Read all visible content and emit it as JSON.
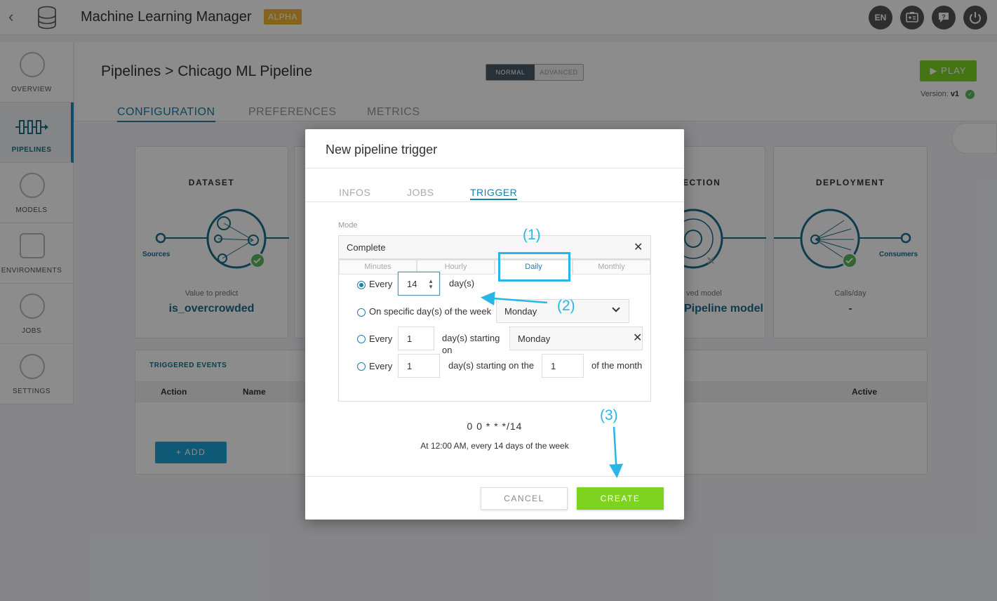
{
  "header": {
    "back_icon": "chevron-left-icon",
    "logo_icon": "database-icon",
    "title": "Machine Learning Manager",
    "badge": "ALPHA",
    "lang": "EN",
    "actions": [
      "id-card-icon",
      "help-chat-icon",
      "power-icon"
    ]
  },
  "sidebar": {
    "items": [
      {
        "label": "OVERVIEW",
        "icon": "dashboard-icon"
      },
      {
        "label": "PIPELINES",
        "icon": "pipelines-icon",
        "active": true
      },
      {
        "label": "MODELS",
        "icon": "atom-icon"
      },
      {
        "label": "ENVIRONMENTS",
        "icon": "environments-icon"
      },
      {
        "label": "JOBS",
        "icon": "jobs-icon"
      },
      {
        "label": "SETTINGS",
        "icon": "gears-icon"
      }
    ]
  },
  "page": {
    "breadcrumb_root": "Pipelines",
    "breadcrumb_sep": ">",
    "breadcrumb_current": "Chicago ML Pipeline",
    "mode_normal": "NORMAL",
    "mode_advanced": "ADVANCED",
    "play_label": "PLAY",
    "version_label": "Version:",
    "version_value": "v1",
    "tabs": [
      "CONFIGURATION",
      "PREFERENCES",
      "METRICS"
    ],
    "active_tab": "CONFIGURATION"
  },
  "stages": {
    "dataset": {
      "title": "DATASET",
      "side_label": "Sources",
      "sub": "Value to predict",
      "value": "is_overcrowded"
    },
    "selection": {
      "title": "ECTION",
      "sub": "ved model",
      "value": "Pipeline model"
    },
    "deployment": {
      "title": "DEPLOYMENT",
      "side_label": "Consumers",
      "sub": "Calls/day",
      "value": "-"
    }
  },
  "events": {
    "title": "TRIGGERED EVENTS",
    "columns": [
      "Action",
      "Name",
      "Active"
    ],
    "add_label": "+  ADD"
  },
  "modal": {
    "title": "New pipeline trigger",
    "tabs": [
      "INFOS",
      "JOBS",
      "TRIGGER"
    ],
    "active_tab": "TRIGGER",
    "mode_label": "Mode",
    "mode_value": "Complete",
    "frequency_tabs": [
      "Minutes",
      "Hourly",
      "Daily",
      "Monthly"
    ],
    "active_frequency": "Daily",
    "options": {
      "every_label": "Every",
      "every_days_value": "14",
      "days_unit": "day(s)",
      "specific_label": "On specific day(s) of the week",
      "specific_day_value": "Monday",
      "every2_value": "1",
      "days_starting_on_1": "day(s) starting",
      "days_starting_on_2": "on",
      "starting_day_value": "Monday",
      "every3_value": "1",
      "days_starting_on_the": "day(s) starting on the",
      "month_day_value": "1",
      "of_the_month": "of the month"
    },
    "cron": "0 0 * * */14",
    "cron_description": "At 12:00 AM, every 14 days of the week",
    "cancel_label": "CANCEL",
    "create_label": "CREATE"
  },
  "annotations": {
    "step1": "(1)",
    "step2": "(2)",
    "step3": "(3)",
    "color": "#29b6e6"
  }
}
